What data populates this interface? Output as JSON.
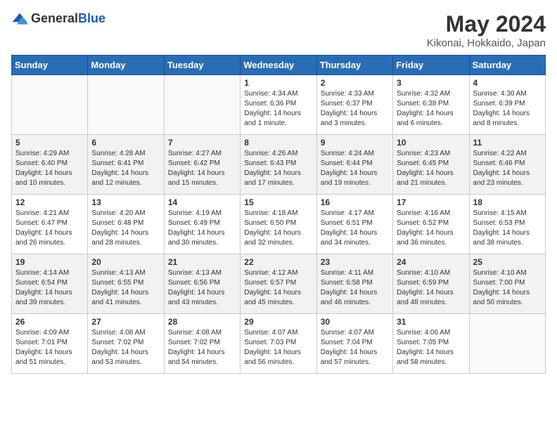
{
  "header": {
    "logo": {
      "general": "General",
      "blue": "Blue"
    },
    "title": "May 2024",
    "location": "Kikonai, Hokkaido, Japan"
  },
  "weekdays": [
    "Sunday",
    "Monday",
    "Tuesday",
    "Wednesday",
    "Thursday",
    "Friday",
    "Saturday"
  ],
  "weeks": [
    [
      {
        "day": "",
        "content": ""
      },
      {
        "day": "",
        "content": ""
      },
      {
        "day": "",
        "content": ""
      },
      {
        "day": "1",
        "content": "Sunrise: 4:34 AM\nSunset: 6:36 PM\nDaylight: 14 hours\nand 1 minute."
      },
      {
        "day": "2",
        "content": "Sunrise: 4:33 AM\nSunset: 6:37 PM\nDaylight: 14 hours\nand 3 minutes."
      },
      {
        "day": "3",
        "content": "Sunrise: 4:32 AM\nSunset: 6:38 PM\nDaylight: 14 hours\nand 6 minutes."
      },
      {
        "day": "4",
        "content": "Sunrise: 4:30 AM\nSunset: 6:39 PM\nDaylight: 14 hours\nand 8 minutes."
      }
    ],
    [
      {
        "day": "5",
        "content": "Sunrise: 4:29 AM\nSunset: 6:40 PM\nDaylight: 14 hours\nand 10 minutes."
      },
      {
        "day": "6",
        "content": "Sunrise: 4:28 AM\nSunset: 6:41 PM\nDaylight: 14 hours\nand 12 minutes."
      },
      {
        "day": "7",
        "content": "Sunrise: 4:27 AM\nSunset: 6:42 PM\nDaylight: 14 hours\nand 15 minutes."
      },
      {
        "day": "8",
        "content": "Sunrise: 4:26 AM\nSunset: 6:43 PM\nDaylight: 14 hours\nand 17 minutes."
      },
      {
        "day": "9",
        "content": "Sunrise: 4:24 AM\nSunset: 6:44 PM\nDaylight: 14 hours\nand 19 minutes."
      },
      {
        "day": "10",
        "content": "Sunrise: 4:23 AM\nSunset: 6:45 PM\nDaylight: 14 hours\nand 21 minutes."
      },
      {
        "day": "11",
        "content": "Sunrise: 4:22 AM\nSunset: 6:46 PM\nDaylight: 14 hours\nand 23 minutes."
      }
    ],
    [
      {
        "day": "12",
        "content": "Sunrise: 4:21 AM\nSunset: 6:47 PM\nDaylight: 14 hours\nand 26 minutes."
      },
      {
        "day": "13",
        "content": "Sunrise: 4:20 AM\nSunset: 6:48 PM\nDaylight: 14 hours\nand 28 minutes."
      },
      {
        "day": "14",
        "content": "Sunrise: 4:19 AM\nSunset: 6:49 PM\nDaylight: 14 hours\nand 30 minutes."
      },
      {
        "day": "15",
        "content": "Sunrise: 4:18 AM\nSunset: 6:50 PM\nDaylight: 14 hours\nand 32 minutes."
      },
      {
        "day": "16",
        "content": "Sunrise: 4:17 AM\nSunset: 6:51 PM\nDaylight: 14 hours\nand 34 minutes."
      },
      {
        "day": "17",
        "content": "Sunrise: 4:16 AM\nSunset: 6:52 PM\nDaylight: 14 hours\nand 36 minutes."
      },
      {
        "day": "18",
        "content": "Sunrise: 4:15 AM\nSunset: 6:53 PM\nDaylight: 14 hours\nand 38 minutes."
      }
    ],
    [
      {
        "day": "19",
        "content": "Sunrise: 4:14 AM\nSunset: 6:54 PM\nDaylight: 14 hours\nand 39 minutes."
      },
      {
        "day": "20",
        "content": "Sunrise: 4:13 AM\nSunset: 6:55 PM\nDaylight: 14 hours\nand 41 minutes."
      },
      {
        "day": "21",
        "content": "Sunrise: 4:13 AM\nSunset: 6:56 PM\nDaylight: 14 hours\nand 43 minutes."
      },
      {
        "day": "22",
        "content": "Sunrise: 4:12 AM\nSunset: 6:57 PM\nDaylight: 14 hours\nand 45 minutes."
      },
      {
        "day": "23",
        "content": "Sunrise: 4:11 AM\nSunset: 6:58 PM\nDaylight: 14 hours\nand 46 minutes."
      },
      {
        "day": "24",
        "content": "Sunrise: 4:10 AM\nSunset: 6:59 PM\nDaylight: 14 hours\nand 48 minutes."
      },
      {
        "day": "25",
        "content": "Sunrise: 4:10 AM\nSunset: 7:00 PM\nDaylight: 14 hours\nand 50 minutes."
      }
    ],
    [
      {
        "day": "26",
        "content": "Sunrise: 4:09 AM\nSunset: 7:01 PM\nDaylight: 14 hours\nand 51 minutes."
      },
      {
        "day": "27",
        "content": "Sunrise: 4:08 AM\nSunset: 7:02 PM\nDaylight: 14 hours\nand 53 minutes."
      },
      {
        "day": "28",
        "content": "Sunrise: 4:08 AM\nSunset: 7:02 PM\nDaylight: 14 hours\nand 54 minutes."
      },
      {
        "day": "29",
        "content": "Sunrise: 4:07 AM\nSunset: 7:03 PM\nDaylight: 14 hours\nand 56 minutes."
      },
      {
        "day": "30",
        "content": "Sunrise: 4:07 AM\nSunset: 7:04 PM\nDaylight: 14 hours\nand 57 minutes."
      },
      {
        "day": "31",
        "content": "Sunrise: 4:06 AM\nSunset: 7:05 PM\nDaylight: 14 hours\nand 58 minutes."
      },
      {
        "day": "",
        "content": ""
      }
    ]
  ]
}
